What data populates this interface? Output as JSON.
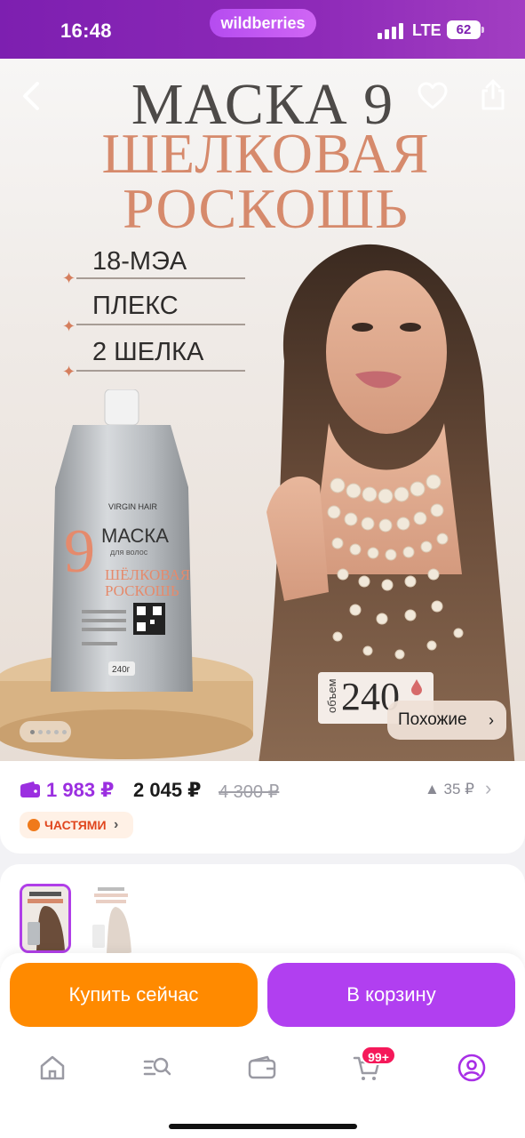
{
  "status_bar": {
    "time": "16:48",
    "brand": "wildberries",
    "network": "LTE",
    "battery": "62"
  },
  "hero": {
    "title_line1": "МАСКА 9",
    "title_line2": "ШЕЛКОВАЯ",
    "title_line3": "РОСКОШЬ",
    "features": [
      "18-МЭА",
      "ПЛЕКС",
      "2 ШЕЛКА"
    ],
    "package": {
      "brand": "VIRGIN HAIR",
      "number": "9",
      "name": "МАСКА",
      "subtitle": "для волос",
      "line1": "ШЁЛКОВАЯ",
      "line2": "РОСКОШЬ",
      "weight": "240г"
    },
    "volume_label": "объем",
    "volume_value": "240",
    "similar_label": "Похожие",
    "image_count": 5,
    "current_image": 1
  },
  "price": {
    "wallet_price": "1 983 ₽",
    "price": "2 045 ₽",
    "old_price": "4 300 ₽",
    "trend": "▲ 35 ₽",
    "parts_label": "ЧАСТЯМИ"
  },
  "actions": {
    "buy_now": "Купить сейчас",
    "add_to_cart": "В корзину"
  },
  "tabbar": {
    "cart_badge": "99+",
    "items": [
      "home-icon",
      "catalog-search-icon",
      "wallet-icon",
      "cart-icon",
      "profile-icon"
    ]
  },
  "colors": {
    "brand_purple": "#b13ff0",
    "buy_orange": "#ff8a00",
    "accent_peach": "#d68a6c"
  }
}
